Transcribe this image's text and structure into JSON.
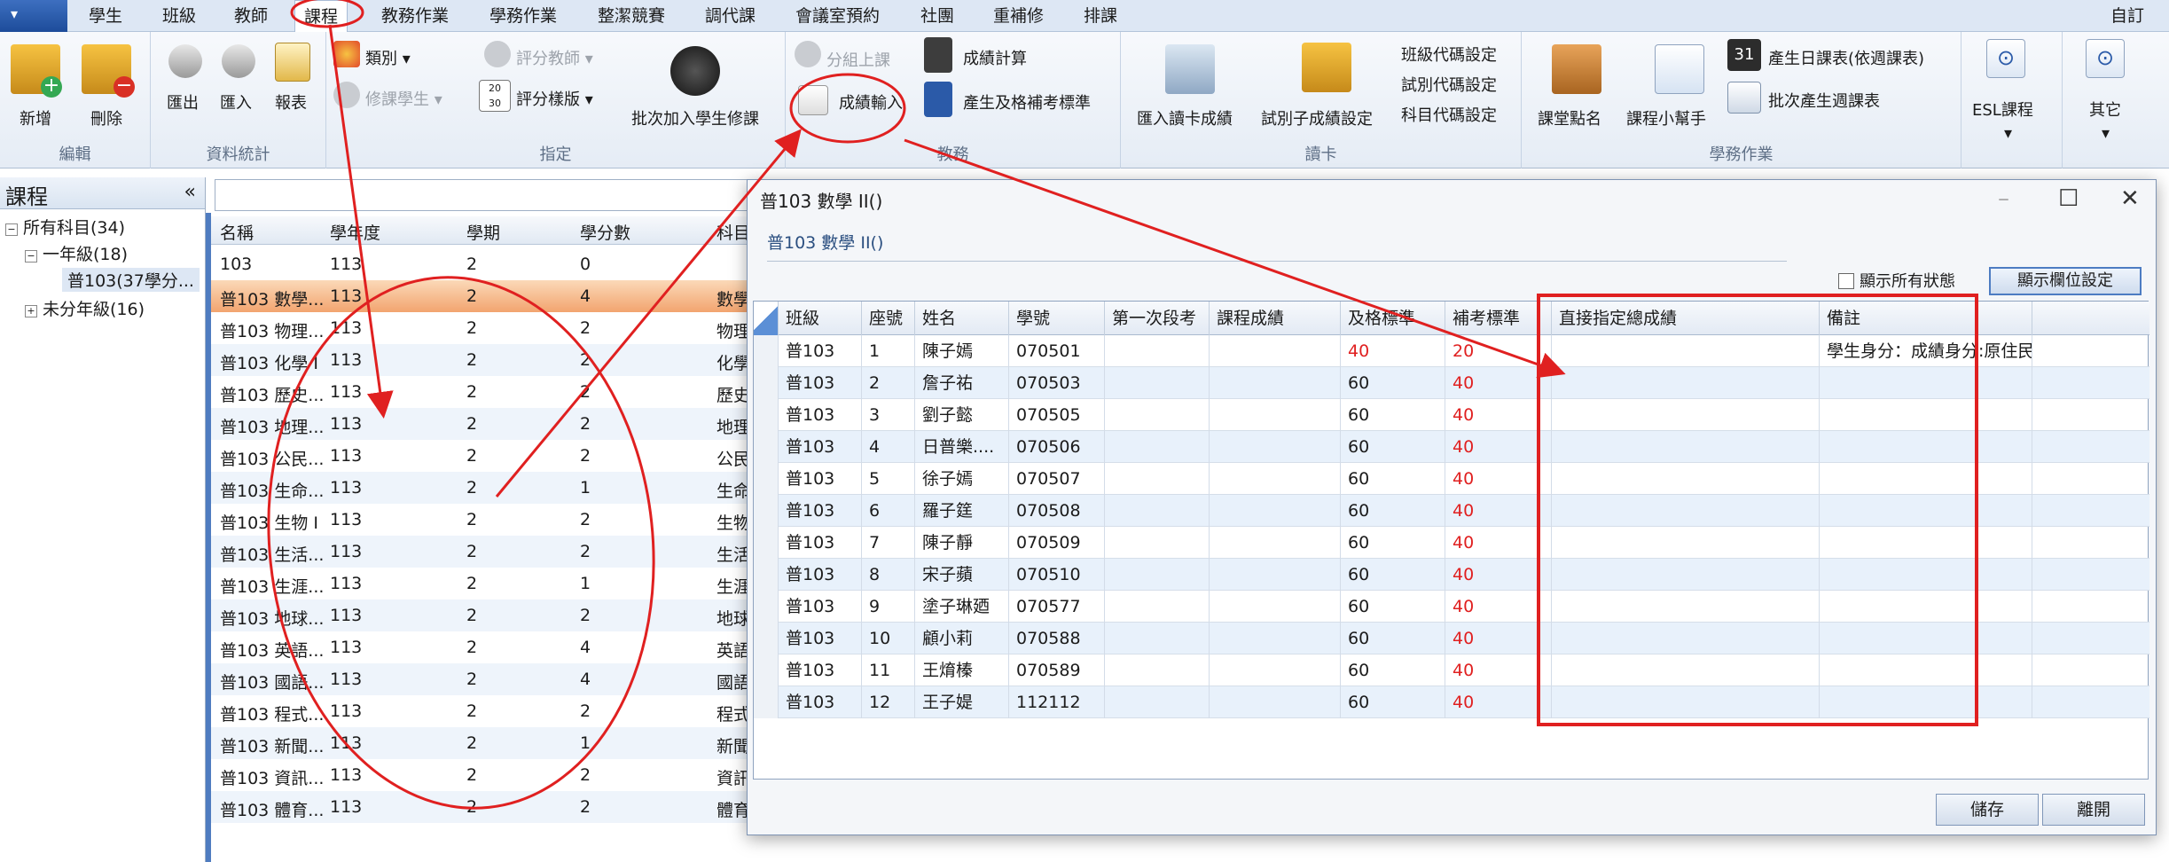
{
  "app": {
    "menu_label": "▾",
    "right_label": "自訂"
  },
  "tabs": [
    "學生",
    "班級",
    "教師",
    "課程",
    "教務作業",
    "學務作業",
    "整潔競賽",
    "調代課",
    "會議室預約",
    "社團",
    "重補修",
    "排課"
  ],
  "ribbon": {
    "edit": {
      "label": "編輯",
      "add": "新增",
      "delete": "刪除"
    },
    "stats": {
      "label": "資料統計",
      "export": "匯出",
      "import": "匯入",
      "report": "報表"
    },
    "assign": {
      "label": "指定",
      "category": "類別",
      "score_teacher": "評分教師",
      "elective_students": "修課學生",
      "score_template": "評分樣版",
      "batch_add": "批次加入學生修課"
    },
    "academic": {
      "label": "教務",
      "group_class": "分組上課",
      "score_input": "成績輸入",
      "score_calc": "成績計算",
      "gen_standard": "產生及格補考標準"
    },
    "card": {
      "label": "讀卡",
      "import_card": "匯入讀卡成績",
      "exam_score_set": "試別子成績設定",
      "class_code": "班級代碼設定",
      "exam_code": "試別代碼設定",
      "subject_code": "科目代碼設定"
    },
    "affairs": {
      "label": "學務作業",
      "rollcall": "課堂點名",
      "helper": "課程小幫手",
      "daily_table": "產生日課表(依週課表)",
      "weekly_batch": "批次產生週課表"
    },
    "esl": "ESL課程",
    "other": "其它"
  },
  "left": {
    "title": "課程",
    "tree": [
      "所有科目(34)",
      "一年級(18)",
      "普103(37學分...",
      "未分年級(16)"
    ]
  },
  "list": {
    "headers": [
      "名稱",
      "學年度",
      "學期",
      "學分數",
      "科目"
    ],
    "rows": [
      [
        "103",
        "113",
        "2",
        "0",
        ""
      ],
      [
        "普103 數學...",
        "113",
        "2",
        "4",
        "數學"
      ],
      [
        "普103 物理...",
        "113",
        "2",
        "2",
        "物理"
      ],
      [
        "普103 化學 I",
        "113",
        "2",
        "2",
        "化學"
      ],
      [
        "普103 歷史...",
        "113",
        "2",
        "2",
        "歷史"
      ],
      [
        "普103 地理...",
        "113",
        "2",
        "2",
        "地理"
      ],
      [
        "普103 公民...",
        "113",
        "2",
        "2",
        "公民"
      ],
      [
        "普103 生命...",
        "113",
        "2",
        "1",
        "生命"
      ],
      [
        "普103 生物 I",
        "113",
        "2",
        "2",
        "生物"
      ],
      [
        "普103 生活...",
        "113",
        "2",
        "2",
        "生活"
      ],
      [
        "普103 生涯...",
        "113",
        "2",
        "1",
        "生涯"
      ],
      [
        "普103 地球...",
        "113",
        "2",
        "2",
        "地球"
      ],
      [
        "普103 英語...",
        "113",
        "2",
        "4",
        "英語"
      ],
      [
        "普103 國語...",
        "113",
        "2",
        "4",
        "國語"
      ],
      [
        "普103 程式...",
        "113",
        "2",
        "2",
        "程式"
      ],
      [
        "普103 新聞...",
        "113",
        "2",
        "1",
        "新聞"
      ],
      [
        "普103 資訊...",
        "113",
        "2",
        "2",
        "資訊"
      ],
      [
        "普103 體育...",
        "113",
        "2",
        "2",
        "體育"
      ]
    ]
  },
  "dialog": {
    "title": "普103 數學 II()",
    "subtitle": "普103 數學 II()",
    "show_all": "顯示所有狀態",
    "col_settings": "顯示欄位設定",
    "headers": [
      "班級",
      "座號",
      "姓名",
      "學號",
      "第一次段考",
      "課程成績",
      "及格標準",
      "補考標準",
      "直接指定總成績",
      "備註"
    ],
    "rows": [
      [
        "普103",
        "1",
        "陳子嫣",
        "070501",
        "",
        "",
        "40",
        "20",
        "",
        "學生身分：成績身分:原住民"
      ],
      [
        "普103",
        "2",
        "詹子祐",
        "070503",
        "",
        "",
        "60",
        "40",
        "",
        ""
      ],
      [
        "普103",
        "3",
        "劉子懿",
        "070505",
        "",
        "",
        "60",
        "40",
        "",
        ""
      ],
      [
        "普103",
        "4",
        "日普樂....",
        "070506",
        "",
        "",
        "60",
        "40",
        "",
        ""
      ],
      [
        "普103",
        "5",
        "徐子嫣",
        "070507",
        "",
        "",
        "60",
        "40",
        "",
        ""
      ],
      [
        "普103",
        "6",
        "羅子筳",
        "070508",
        "",
        "",
        "60",
        "40",
        "",
        ""
      ],
      [
        "普103",
        "7",
        "陳子靜",
        "070509",
        "",
        "",
        "60",
        "40",
        "",
        ""
      ],
      [
        "普103",
        "8",
        "宋子蘋",
        "070510",
        "",
        "",
        "60",
        "40",
        "",
        ""
      ],
      [
        "普103",
        "9",
        "塗子琳廼",
        "070577",
        "",
        "",
        "60",
        "40",
        "",
        ""
      ],
      [
        "普103",
        "10",
        "顧小莉",
        "070588",
        "",
        "",
        "60",
        "40",
        "",
        ""
      ],
      [
        "普103",
        "11",
        "王焴榛",
        "070589",
        "",
        "",
        "60",
        "40",
        "",
        ""
      ],
      [
        "普103",
        "12",
        "王子媞",
        "112112",
        "",
        "",
        "60",
        "40",
        "",
        ""
      ]
    ],
    "save": "儲存",
    "close": "離開"
  },
  "colors": {
    "annotation_red": "#e02020",
    "selected_row": "#f2a46f",
    "accent": "#2b5aa8"
  }
}
